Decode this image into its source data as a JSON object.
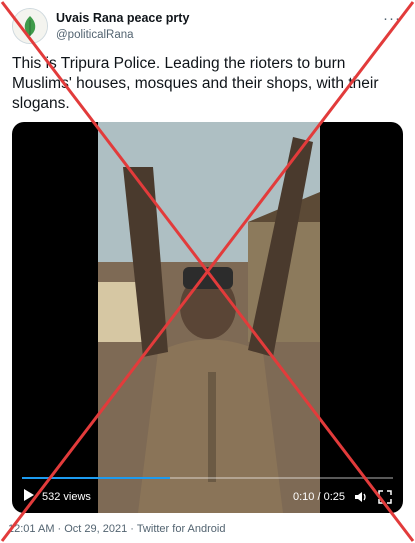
{
  "tweet": {
    "author_name": "Uvais Rana peace prty",
    "author_handle": "@politicalRana",
    "more_icon": "more-icon",
    "text": "This is Tripura Police. Leading the rioters to burn Muslims' houses, mosques and their shops, with their slogans."
  },
  "video": {
    "views": "532 views",
    "time": "0:10 / 0:25",
    "progress_fraction": 0.4,
    "accent_color": "#1d9bf0"
  },
  "footer": {
    "meta": "12:01 AM · Oct 29, 2021 · Twitter for Android"
  },
  "overlay": {
    "cross_color": "#e23b3b"
  }
}
